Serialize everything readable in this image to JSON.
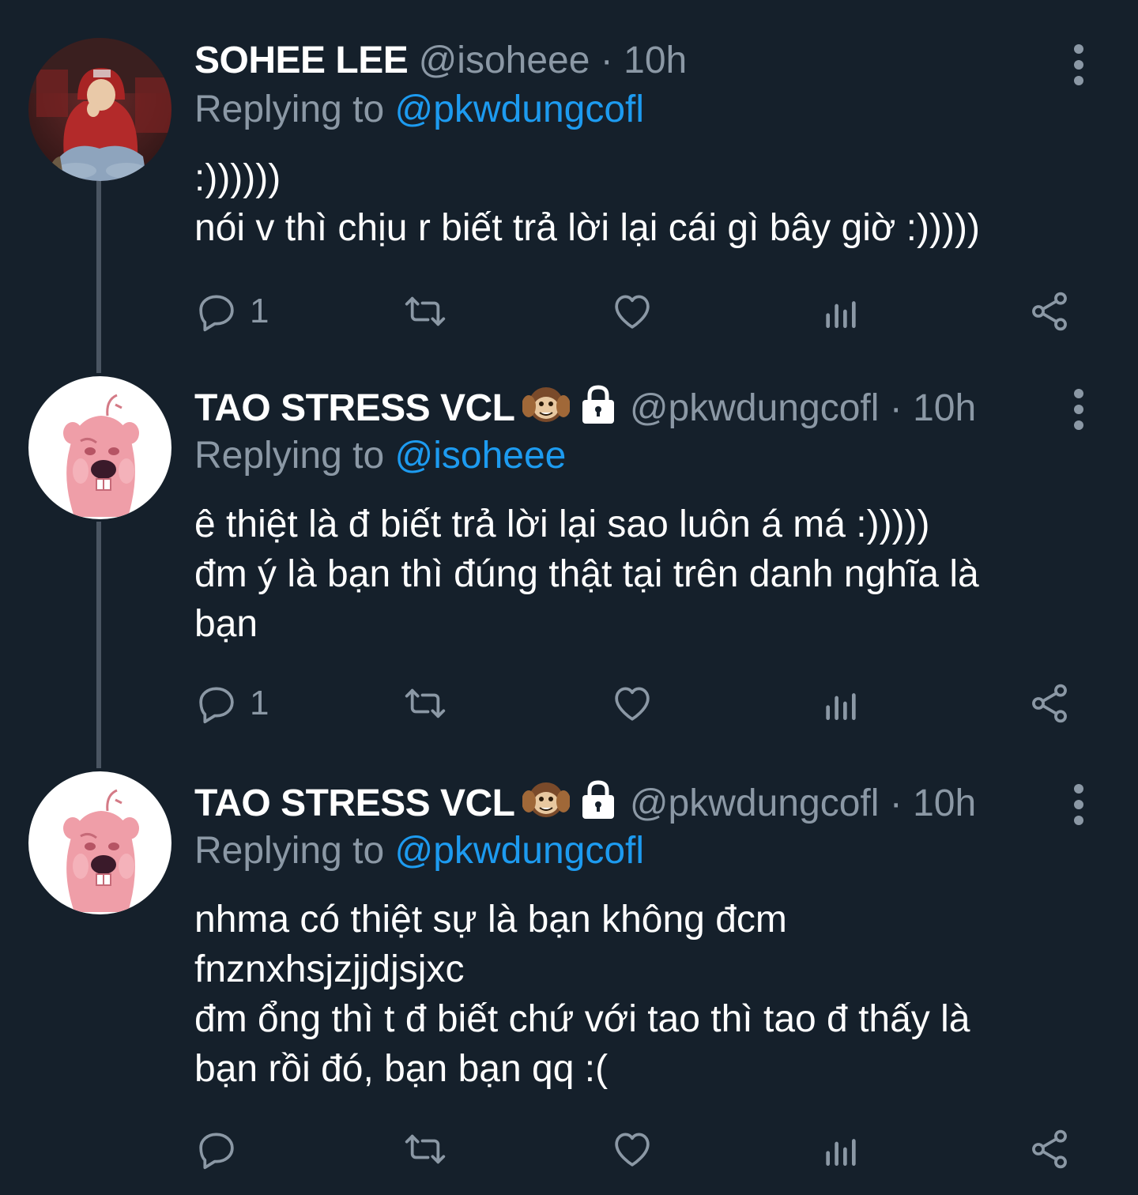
{
  "colors": {
    "background": "#15202b",
    "text_primary": "#ffffff",
    "text_secondary": "#8b98a5",
    "link": "#1d9bf0",
    "thread_line": "#4a5562"
  },
  "tweets": [
    {
      "name": "SOHEE LEE",
      "name_emojis": [],
      "handle": "@isoheee",
      "separator": "·",
      "time": "10h",
      "replying_prefix": "Replying to",
      "replying_to": "@pkwdungcofl",
      "avatar": "avatar-photo-person-red-hoodie",
      "lines": [
        ":))))))",
        "nói v thì chịu r biết trả lời lại cái gì bây giờ :)))))"
      ],
      "reply_count": "1",
      "icons": [
        "reply-icon",
        "retweet-icon",
        "like-icon",
        "analytics-icon",
        "share-icon"
      ]
    },
    {
      "name": "TAO STRESS VCL",
      "name_emojis": [
        "hear-no-evil-monkey-emoji",
        "lock-icon"
      ],
      "handle": "@pkwdungcofl",
      "separator": "·",
      "time": "10h",
      "replying_prefix": "Replying to",
      "replying_to": "@isoheee",
      "avatar": "avatar-pink-beaver",
      "lines": [
        "ê thiệt là đ biết trả lời lại sao luôn á má :)))))",
        "đm ý là bạn thì đúng thật tại trên danh nghĩa là",
        "bạn"
      ],
      "reply_count": "1",
      "icons": [
        "reply-icon",
        "retweet-icon",
        "like-icon",
        "analytics-icon",
        "share-icon"
      ]
    },
    {
      "name": "TAO STRESS VCL",
      "name_emojis": [
        "hear-no-evil-monkey-emoji",
        "lock-icon"
      ],
      "handle": "@pkwdungcofl",
      "separator": "·",
      "time": "10h",
      "replying_prefix": "Replying to",
      "replying_to": "@pkwdungcofl",
      "avatar": "avatar-pink-beaver",
      "lines": [
        "nhma có thiệt sự là bạn không đcm",
        "fnznxhsjzjjdjsjxc",
        "đm ổng thì t đ biết chứ với tao thì tao đ thấy là",
        "bạn rồi đó, bạn bạn qq :("
      ],
      "reply_count": "",
      "icons": [
        "reply-icon",
        "retweet-icon",
        "like-icon",
        "analytics-icon",
        "share-icon"
      ]
    }
  ]
}
